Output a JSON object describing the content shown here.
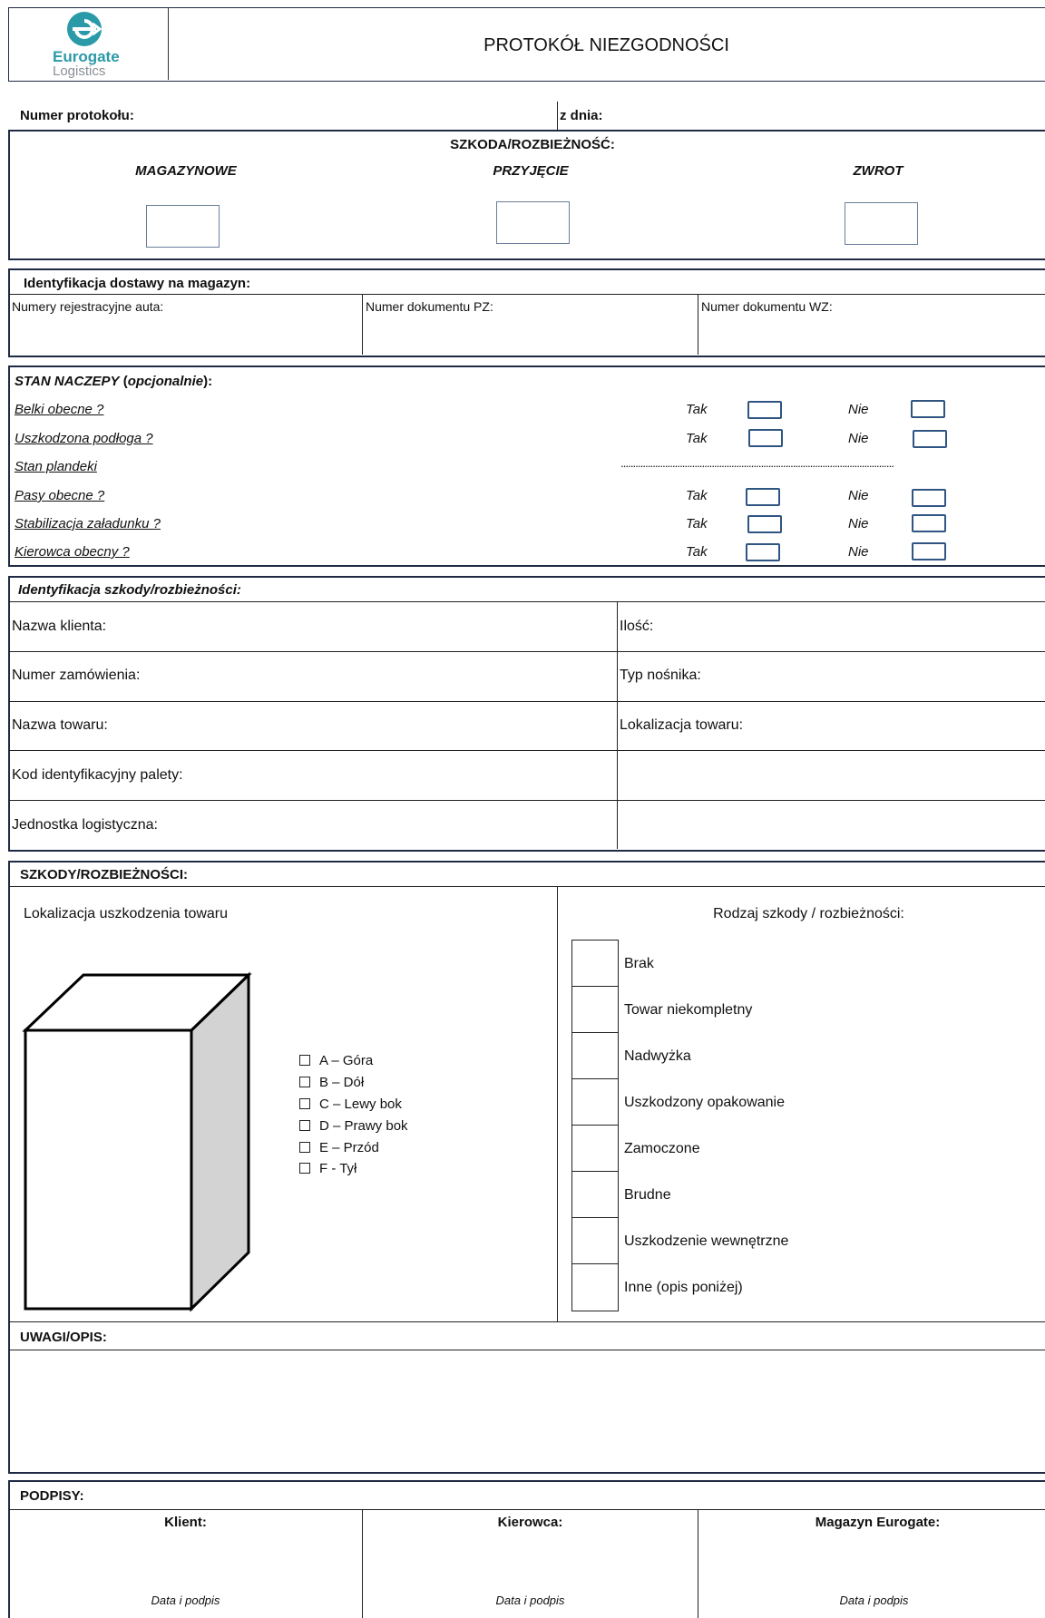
{
  "header": {
    "logo_brand": "Eurogate",
    "logo_sub": "Logistics",
    "title": "PROTOKÓŁ NIEZGODNOŚCI"
  },
  "protocol": {
    "number_label": "Numer protokołu:",
    "date_label": "z dnia:"
  },
  "damage_type": {
    "heading": "SZKODA/ROZBIEŻNOŚĆ:",
    "options": [
      "MAGAZYNOWE",
      "PRZYJĘCIE",
      "ZWROT"
    ]
  },
  "delivery": {
    "heading": "Identyfikacja dostawy na magazyn:",
    "fields": [
      "Numery rejestracyjne auta:",
      "Numer dokumentu PZ:",
      "Numer dokumentu WZ:"
    ]
  },
  "trailer": {
    "heading_main": "STAN NACZEPY",
    "heading_paren_open": "(",
    "heading_opt": "opcjonalnie",
    "heading_paren_close": "):",
    "yes_label": "Tak",
    "no_label": "Nie",
    "dots": "...............................................................................................................",
    "items": [
      "Belki obecne ?",
      "Uszkodzona podłoga ?",
      "Stan plandeki",
      "Pasy obecne ?",
      "Stabilizacja załadunku ?",
      "Kierowca obecny ?"
    ]
  },
  "identification": {
    "heading": "Identyfikacja szkody/rozbieżności:",
    "left_fields": [
      "Nazwa klienta:",
      "Numer zamówienia:",
      "Nazwa towaru:",
      "Kod identyfikacyjny palety:",
      "Jednostka logistyczna:"
    ],
    "right_fields": [
      "Ilość:",
      "Typ nośnika:",
      "Lokalizacja towaru:",
      "",
      ""
    ]
  },
  "damages": {
    "heading": "SZKODY/ROZBIEŻNOŚCI:",
    "location_label": "Lokalizacja uszkodzenia towaru",
    "locations": [
      "A – Góra",
      "B – Dół",
      "C – Lewy bok",
      "D – Prawy bok",
      "E – Przód",
      "F - Tył"
    ],
    "type_label": "Rodzaj szkody / rozbieżności:",
    "types": [
      "Brak",
      "Towar niekompletny",
      "Nadwyżka",
      "Uszkodzony opakowanie",
      "Zamoczone",
      "Brudne",
      "Uszkodzenie wewnętrzne",
      "Inne (opis poniżej)"
    ]
  },
  "remarks": {
    "heading": "UWAGI/OPIS:"
  },
  "signatures": {
    "heading": "PODPISY:",
    "columns": [
      "Klient:",
      "Kierowca:",
      "Magazyn Eurogate:"
    ],
    "sub_label": "Data i podpis"
  },
  "colors": {
    "frame": "#1f2a44",
    "checkbox_blue": "#2f5582",
    "logo_teal": "#2a9aa8",
    "logo_grey": "#8a8f96"
  }
}
